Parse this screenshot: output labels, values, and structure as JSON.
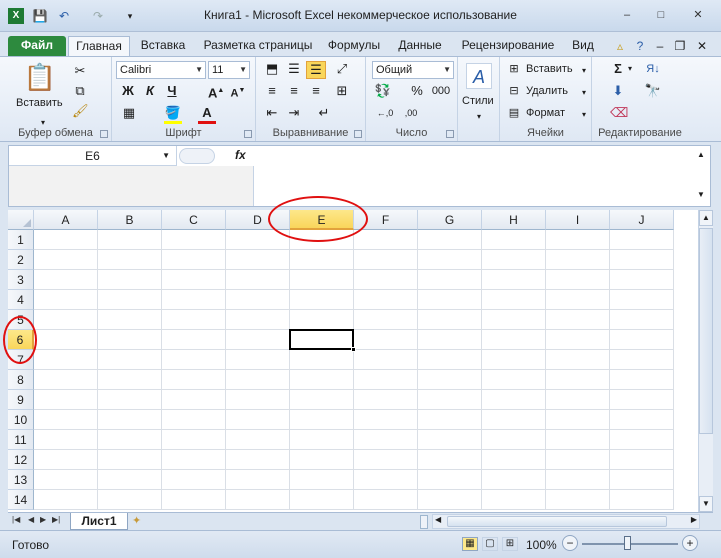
{
  "window": {
    "title": "Книга1  -  Microsoft Excel некоммерческое использование",
    "minimize": "–",
    "maximize": "□",
    "close": "✕"
  },
  "tabs": [
    {
      "label": "Файл"
    },
    {
      "label": "Главная"
    },
    {
      "label": "Вставка"
    },
    {
      "label": "Разметка страницы"
    },
    {
      "label": "Формулы"
    },
    {
      "label": "Данные"
    },
    {
      "label": "Рецензирование"
    },
    {
      "label": "Вид"
    }
  ],
  "ribbon": {
    "clipboard": {
      "label": "Буфер обмена",
      "paste": "Вставить"
    },
    "font": {
      "label": "Шрифт",
      "name": "Calibri",
      "size": "11",
      "bold": "Ж",
      "italic": "К",
      "underline": "Ч"
    },
    "alignment": {
      "label": "Выравнивание"
    },
    "number": {
      "label": "Число",
      "format": "Общий"
    },
    "styles": {
      "label": "Стили"
    },
    "cells": {
      "label": "Ячейки",
      "insert": "Вставить",
      "delete": "Удалить",
      "format": "Формат"
    },
    "editing": {
      "label": "Редактирование"
    }
  },
  "formula_bar": {
    "name_box": "E6",
    "fx": "fx",
    "value": ""
  },
  "grid": {
    "columns": [
      "A",
      "B",
      "C",
      "D",
      "E",
      "F",
      "G",
      "H",
      "I",
      "J"
    ],
    "rows": [
      "1",
      "2",
      "3",
      "4",
      "5",
      "6",
      "7",
      "8",
      "9",
      "10",
      "11",
      "12",
      "13",
      "14"
    ],
    "selected_column": "E",
    "selected_row": "6"
  },
  "sheets": {
    "active": "Лист1"
  },
  "status": {
    "ready": "Готово",
    "zoom": "100%"
  },
  "colors": {
    "annotation": "#e01010",
    "selection": "#f9d65b",
    "file_tab": "#2d8a3e"
  }
}
